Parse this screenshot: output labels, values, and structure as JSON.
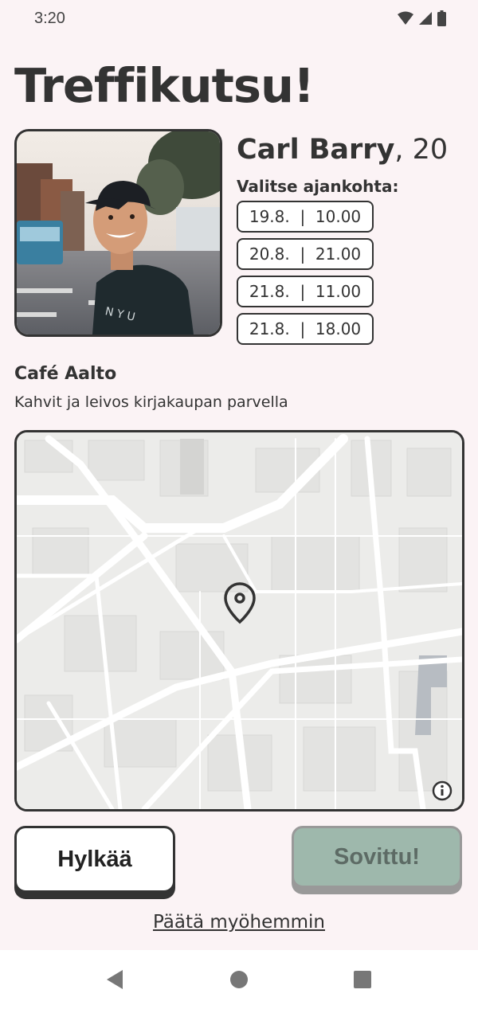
{
  "status": {
    "time": "3:20"
  },
  "title": "Treffikutsu!",
  "profile": {
    "name": "Carl Barry",
    "age_text": ", 20"
  },
  "schedule": {
    "label": "Valitse ajankohta:",
    "slots": [
      "19.8.  |  10.00",
      "20.8.  |  21.00",
      "21.8.  |  11.00",
      "21.8.  |  18.00"
    ]
  },
  "place": {
    "name": "Café Aalto",
    "description": "Kahvit ja leivos kirjakaupan parvella"
  },
  "actions": {
    "reject_label": "Hylkää",
    "accept_label": "Sovittu!",
    "later_label": "Päätä myöhemmin"
  },
  "icons": {
    "wifi": "wifi-icon",
    "signal": "signal-icon",
    "battery": "battery-icon",
    "pin": "location-pin-icon",
    "info": "info-icon",
    "back": "back-icon",
    "home": "home-icon",
    "recents": "recents-icon"
  },
  "colors": {
    "background": "#fbf3f5",
    "text": "#333333",
    "accept_button": "#9eb8ac",
    "accept_text": "#5d6b65"
  }
}
